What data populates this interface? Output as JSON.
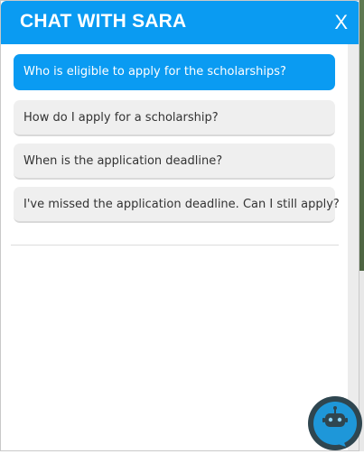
{
  "header": {
    "title": "CHAT WITH SARA",
    "close_label": "X"
  },
  "options": [
    {
      "label": "Who is eligible to apply for the scholarships?",
      "state": "active"
    },
    {
      "label": "How do I apply for a scholarship?",
      "state": "default"
    },
    {
      "label": "When is the application deadline?",
      "state": "default"
    },
    {
      "label": "I've missed the application deadline. Can I still apply?",
      "state": "default"
    }
  ],
  "launcher": {
    "icon": "chatbot-icon"
  },
  "colors": {
    "accent": "#0a9bf2",
    "option_bg": "#efefef",
    "launcher_ring": "#2f4650",
    "launcher_bubble": "#1e97d9"
  }
}
